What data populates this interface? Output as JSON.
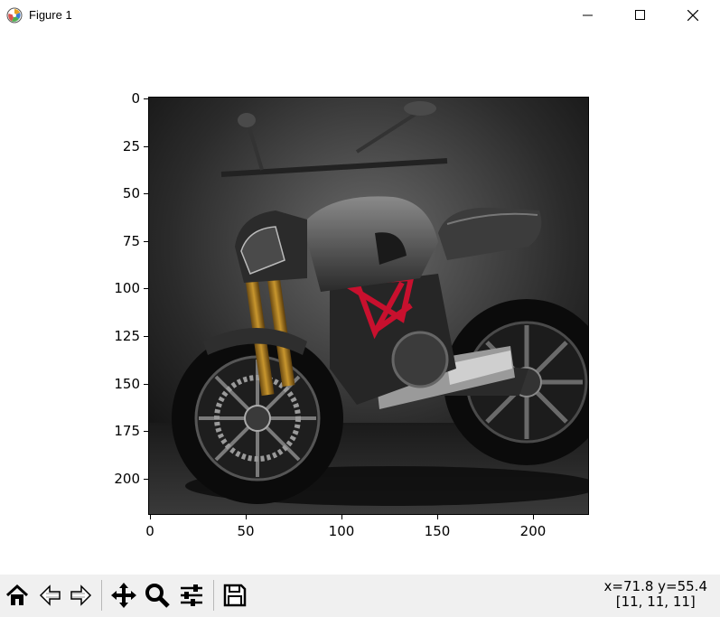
{
  "window": {
    "title": "Figure 1",
    "icon": "matplotlib-logo-icon",
    "controls": [
      "minimize-icon",
      "maximize-icon",
      "close-icon"
    ]
  },
  "figure": {
    "image": {
      "description_icon": "motorcycle-image",
      "x_extent": [
        0,
        230
      ],
      "y_extent": [
        220,
        0
      ]
    },
    "x_ticks": [
      "0",
      "50",
      "100",
      "150",
      "200"
    ],
    "y_ticks": [
      "0",
      "25",
      "50",
      "75",
      "100",
      "125",
      "150",
      "175",
      "200"
    ]
  },
  "toolbar": {
    "buttons": [
      "home-icon",
      "back-icon",
      "forward-icon",
      "pan-icon",
      "zoom-icon",
      "configure-subplots-icon",
      "save-icon"
    ]
  },
  "status": {
    "coords": "x=71.8 y=55.4",
    "pixel_value": "[11, 11, 11]"
  },
  "colors": {
    "frame_red": "#c8102e",
    "background": "#ffffff",
    "toolbar_bg": "#f0f0f0"
  }
}
